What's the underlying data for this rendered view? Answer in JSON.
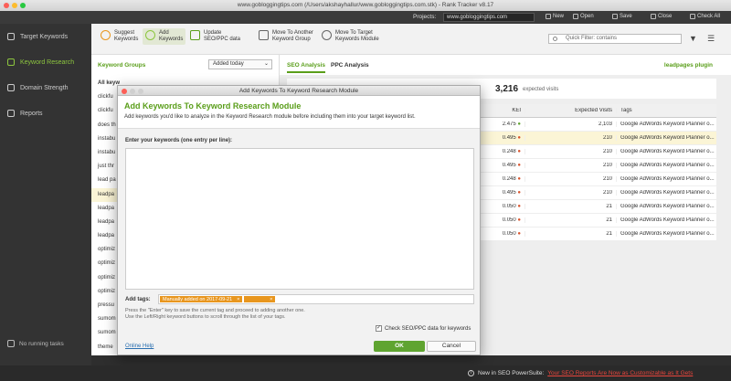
{
  "window": {
    "title": "www.gobloggingtips.com (/Users/akshayhallur/www.gobloggingtips.com.stk) - Rank Tracker v8.17"
  },
  "project_bar": {
    "projects_label": "Projects:",
    "project_value": "www.gobloggingtips.com",
    "buttons": [
      "New",
      "Open",
      "Save",
      "Close",
      "Check All"
    ]
  },
  "nav": {
    "items": [
      "Target Keywords",
      "Keyword Research",
      "Domain Strength",
      "Reports"
    ],
    "status": "No running tasks"
  },
  "toolbar": {
    "suggest": "Suggest Keywords",
    "add": "Add Keywords",
    "update": "Update SEO/PPC data",
    "move_group": "Move To Another Keyword Group",
    "move_target": "Move To Target Keywords Module",
    "filter_placeholder": "Quick Filter: contains"
  },
  "keyword_groups": {
    "title": "Keyword Groups",
    "sort": "Added today",
    "items": [
      "All keyw",
      "clickfu",
      "clickfu",
      "does th",
      "instabu",
      "instabu",
      "just thr",
      "lead pa",
      "leadpa",
      "leadpa",
      "leadpa",
      "leadpa",
      "optimiz",
      "optimiz",
      "optimiz",
      "optimiz",
      "pressu",
      "sumom",
      "sumom",
      "theme"
    ]
  },
  "right_panel": {
    "tabs": [
      "SEO Analysis",
      "PPC Analysis"
    ],
    "plugin_label": "leadpages plugin",
    "summary_number": "3,216",
    "summary_label": "expected visits",
    "columns": [
      "KEI",
      "Expected Visits",
      "Tags"
    ],
    "rows": [
      {
        "kei": "2.475",
        "status": "green",
        "visits": "2,103",
        "tags": "Google AdWords Keyword Planner o..."
      },
      {
        "kei": "0.495",
        "status": "red",
        "visits": "210",
        "tags": "Google AdWords Keyword Planner o..."
      },
      {
        "kei": "0.248",
        "status": "red",
        "visits": "210",
        "tags": "Google AdWords Keyword Planner o..."
      },
      {
        "kei": "0.495",
        "status": "red",
        "visits": "210",
        "tags": "Google AdWords Keyword Planner o..."
      },
      {
        "kei": "0.248",
        "status": "red",
        "visits": "210",
        "tags": "Google AdWords Keyword Planner o..."
      },
      {
        "kei": "0.495",
        "status": "red",
        "visits": "210",
        "tags": "Google AdWords Keyword Planner o..."
      },
      {
        "kei": "0.050",
        "status": "red",
        "visits": "21",
        "tags": "Google AdWords Keyword Planner o..."
      },
      {
        "kei": "0.050",
        "status": "red",
        "visits": "21",
        "tags": "Google AdWords Keyword Planner o..."
      },
      {
        "kei": "0.050",
        "status": "red",
        "visits": "21",
        "tags": "Google AdWords Keyword Planner o..."
      }
    ]
  },
  "dialog": {
    "window_title": "Add Keywords To Keyword Research Module",
    "heading": "Add Keywords To Keyword Research Module",
    "description": "Add keywords you'd like to analyze in the Keyword Research module before including them into your target keyword list.",
    "prompt": "Enter your keywords (one entry per line):",
    "keywords_value": "",
    "tags_label": "Add tags:",
    "tag_value": "Manually added on 2017-09-21",
    "hint_line1": "Press the \"Enter\" key to save the current tag and proceed to adding another one.",
    "hint_line2": "Use the Left/Right keyword buttons to scroll through the list of your tags.",
    "check_label": "Check SEO/PPC data for keywords",
    "help_link": "Online Help",
    "ok": "OK",
    "cancel": "Cancel"
  },
  "bottom_bar": {
    "news_prefix": "New in SEO PowerSuite:",
    "news_link": "Your SEO Reports Are Now as Customizable as It Gets"
  },
  "colors": {
    "accent": "#5a9e1a",
    "ok_button": "#5fa430",
    "tag": "#e8961e",
    "highlight": "#fbf5d6",
    "link_red": "#e8453c"
  }
}
